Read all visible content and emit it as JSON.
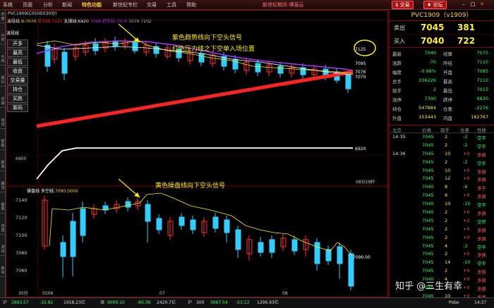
{
  "menu": {
    "items": [
      "系统",
      "页面",
      "分析",
      "新闻",
      "特色功能",
      "新世纪专栏",
      "交易",
      "工具",
      "帮助"
    ],
    "active_index": 4,
    "app_title": "新世纪期货-博易云",
    "trade_btn": "交易",
    "forum_btn": "论坛"
  },
  "left_strip": [
    "开盘",
    "分时",
    "K线",
    "报价",
    "交易",
    "资讯",
    "帮助",
    "新闻",
    "期货",
    "图表",
    "自选",
    "测试",
    "板块"
  ],
  "chart": {
    "header": "PVC1909(C0509)(30分)",
    "ma_legend": {
      "label": "波段线",
      "b": "B:7070",
      "pressure": "压力线:7125",
      "support": "支撑线:6920",
      "value": "7098",
      "trend": "趋势线:7076",
      "extra": "7070",
      "extra2": "7102"
    },
    "side_buttons": [
      "开多",
      "最高",
      "最低",
      "收盘",
      "交易量",
      "持仓",
      "买跌",
      "筹码"
    ],
    "price_labels_top": [
      "7125",
      "7095",
      "7076",
      "7070"
    ],
    "support_label": "6920",
    "label_6900": "6900",
    "period_label": "08分29秒",
    "vol_legend": {
      "label": "操盘线 多空线:",
      "value": "7090.0000"
    },
    "vol_right_label": "7090.00",
    "y_axis_lower": [
      "7140",
      "7120",
      "7100",
      "7080",
      "7060"
    ],
    "x_axis": [
      "30分",
      "0506",
      "07",
      "08"
    ],
    "annotations": {
      "purple": "紫色趋势线向下空头信号",
      "red": "红色压力线之下空单入场位置",
      "yellow": "黄色操盘线向下空头信号"
    }
  },
  "quote": {
    "title": "PVC1909（v1909）",
    "sell_label": "卖出",
    "sell_price": "7045",
    "sell_vol": "381",
    "buy_label": "买入",
    "buy_price": "7040",
    "buy_vol": "722",
    "stats": [
      [
        "最新",
        "7040",
        "结算",
        "7075"
      ],
      [
        "涨跌",
        "-70",
        "昨结",
        "7110"
      ],
      [
        "幅度",
        "-0.98%",
        "开盘",
        "7085"
      ],
      [
        "总手",
        "336226",
        "最高",
        "7110"
      ],
      [
        "现手",
        "2",
        "最低",
        "7015"
      ],
      [
        "涨停",
        "7390",
        "跌停",
        "6830"
      ],
      [
        "持仓",
        "547884",
        "仓差",
        "-2276"
      ],
      [
        "外盘",
        "153443",
        "内盘",
        "182767"
      ]
    ],
    "tick_headers": [
      "北京",
      "价格",
      "现手",
      "仓差",
      "性质"
    ],
    "ticks": [
      [
        "14:35",
        "7045",
        "2",
        "-2",
        "空平"
      ],
      [
        "",
        "7045",
        "2",
        "-2",
        "空平"
      ],
      [
        "14:36",
        "7045",
        "10",
        "+0",
        "多换"
      ],
      [
        "",
        "7045",
        "2",
        "-2",
        "空平"
      ],
      [
        "",
        "7045",
        "10",
        "+0",
        "多换"
      ],
      [
        "",
        "7045",
        "12",
        "+0",
        "多换"
      ],
      [
        "",
        "7040",
        "8",
        "-6",
        "多平"
      ],
      [
        "",
        "7045",
        "6",
        "+0",
        "多换"
      ],
      [
        "",
        "7040",
        "10",
        "-10",
        "空平"
      ],
      [
        "",
        "7040",
        "2",
        "+0",
        "多换"
      ],
      [
        "",
        "7045",
        "2",
        "+2",
        "空开"
      ],
      [
        "",
        "7045",
        "2",
        "+0",
        "多换"
      ],
      [
        "",
        "7045",
        "2",
        "+0",
        "多换"
      ],
      [
        "",
        "7045",
        "4",
        "-2",
        "空平"
      ],
      [
        "",
        "7045",
        "2",
        "+0",
        "多换"
      ],
      [
        "",
        "7045",
        "14",
        "-10",
        "空平"
      ],
      [
        "",
        "7045",
        "2",
        "+0",
        "多换"
      ],
      [
        "",
        "7040",
        "4",
        "+0",
        "多换"
      ],
      [
        "",
        "7040",
        "2",
        "+0",
        "多换"
      ],
      [
        "",
        "7040",
        "10",
        "+0",
        "多换"
      ]
    ],
    "bottom_tabs": "财",
    "pobo": "Pobo",
    "clock": "14:37"
  },
  "statusbar": {
    "items": [
      "沪",
      "2893.57",
      "-32.82",
      "1958.23亿",
      "深",
      "9009.10",
      "-80.36",
      "2420.7亿",
      "沪",
      "300",
      "3667.54",
      "-53.13",
      "1296.93亿"
    ]
  },
  "watermark": "知乎 @三生有幸",
  "colors": {
    "up": "#ff3333",
    "down": "#33ccff",
    "accent": "#ffee00",
    "purple": "#aa33ff",
    "frame": "#880000"
  }
}
